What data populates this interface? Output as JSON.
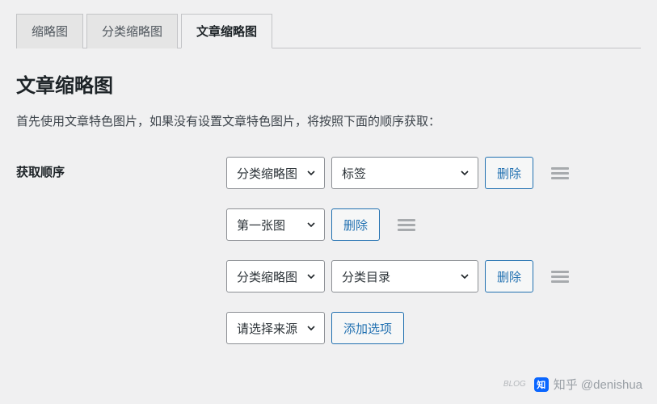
{
  "tabs": [
    {
      "label": "缩略图",
      "active": false
    },
    {
      "label": "分类缩略图",
      "active": false
    },
    {
      "label": "文章缩略图",
      "active": true
    }
  ],
  "page_title": "文章缩略图",
  "description": "首先使用文章特色图片，如果没有设置文章特色图片，将按照下面的顺序获取：",
  "form": {
    "order_label": "获取顺序",
    "delete_label": "删除",
    "add_label": "添加选项",
    "rules": [
      {
        "source": "分类缩略图",
        "target": "标签",
        "has_target": true
      },
      {
        "source": "第一张图",
        "target": null,
        "has_target": false
      },
      {
        "source": "分类缩略图",
        "target": "分类目录",
        "has_target": true
      }
    ],
    "new_source_placeholder": "请选择来源"
  },
  "watermark": {
    "logo_text": "知",
    "sublogo": "BLOG",
    "handle": "知乎 @denishua"
  }
}
